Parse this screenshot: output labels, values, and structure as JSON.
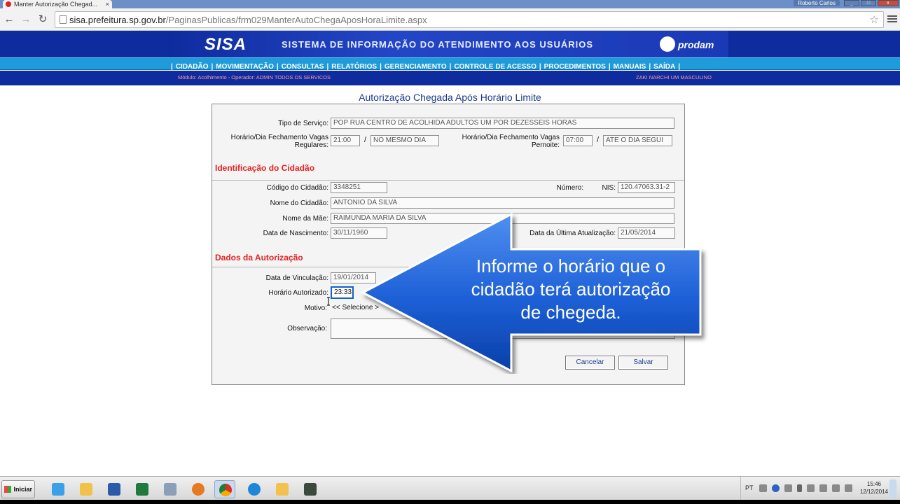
{
  "browser": {
    "tab_title": "Manter Autorização Chegad...",
    "tab_close": "×",
    "user_badge": "Roberto Carlos",
    "url_host": "sisa.prefeitura.sp.gov.br",
    "url_path": "/PaginasPublicas/frm029ManterAutoChegaAposHoraLimite.aspx"
  },
  "header": {
    "logo": "SISA",
    "system_title": "SISTEMA DE INFORMAÇÃO DO ATENDIMENTO AOS USUÁRIOS",
    "brand": "prodam"
  },
  "menu": {
    "items": [
      "CIDADÃO",
      "MOVIMENTAÇÃO",
      "CONSULTAS",
      "RELATÓRIOS",
      "GERENCIAMENTO",
      "CONTROLE DE ACESSO",
      "PROCEDIMENTOS",
      "MANUAIS",
      "SAÍDA"
    ],
    "sep": "|"
  },
  "infobar": {
    "module": "Módulo: Acolhimento - Operador: ADMIN TODOS OS SERVICOS",
    "user": "ZAKI NARCHI UM MASCULINO"
  },
  "form": {
    "title": "Autorização Chegada Após Horário Limite",
    "tipo_servico_label": "Tipo de Serviço:",
    "tipo_servico_value": "POP RUA CENTRO DE ACOLHIDA ADULTOS UM POR DEZESSEIS HORAS",
    "regulares_label_1": "Horário/Dia Fechamento Vagas",
    "regulares_label_2": "Regulares:",
    "regulares_hora": "21:00",
    "regulares_dia": "NO MESMO DIA",
    "pernoite_label_1": "Horário/Dia Fechamento Vagas",
    "pernoite_label_2": "Pernoite:",
    "pernoite_hora": "07:00",
    "pernoite_dia": "ATE O DIA SEGUI",
    "slash": "/",
    "sec_cidadao": "Identificação do Cidadão",
    "codigo_label": "Código do Cidadão:",
    "codigo_value": "3348251",
    "numero_label": "Número:",
    "nis_label": "NIS:",
    "nis_value": "120.47063.31-2",
    "nome_label": "Nome do Cidadão:",
    "nome_value": "ANTONIO DA SILVA",
    "mae_label": "Nome da Mãe:",
    "mae_value": "RAIMUNDA MARIA DA SILVA",
    "nasc_label": "Data de Nascimento:",
    "nasc_value": "30/11/1960",
    "atual_label": "Data da Última Atualização:",
    "atual_value": "21/05/2014",
    "sec_autorizacao": "Dados da Autorização",
    "vinc_label": "Data de Vinculação:",
    "vinc_value": "19/01/2014",
    "horario_label": "Horário Autorizado:",
    "horario_value": "23:33",
    "motivo_label": "Motivo:",
    "motivo_value": "<< Selecione >",
    "obs_label": "Observação:",
    "cancelar": "Cancelar",
    "salvar": "Salvar"
  },
  "callout": {
    "line1": "Informe o horário que o",
    "line2": "cidadão terá autorização",
    "line3": "de chegeda."
  },
  "taskbar": {
    "start": "Iniciar",
    "lang": "PT",
    "time": "15:46",
    "date": "12/12/2014"
  }
}
